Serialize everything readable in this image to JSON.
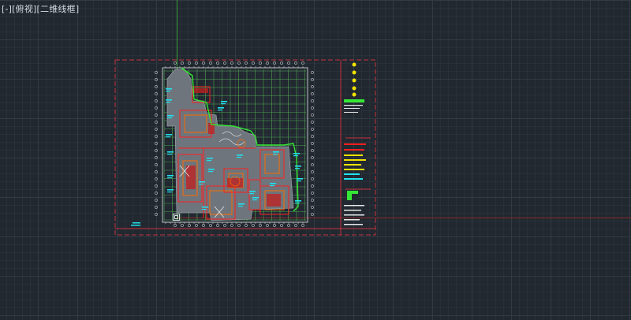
{
  "viewport": {
    "label": "[-][俯视][二维线框]",
    "background": "#212830"
  },
  "colors": {
    "frame_red": "#c8323c",
    "grid_green": "#4fa34f",
    "outline_green": "#35e635",
    "wall_grey": "#8a9096",
    "plan_red": "#ff2020",
    "annotation_cyan": "#20e0f0",
    "text_yellow": "#f0e000",
    "white": "#e8e8e8"
  },
  "icons": {
    "ucs": "ucs-icon",
    "cursor": "crosshair-cursor"
  }
}
